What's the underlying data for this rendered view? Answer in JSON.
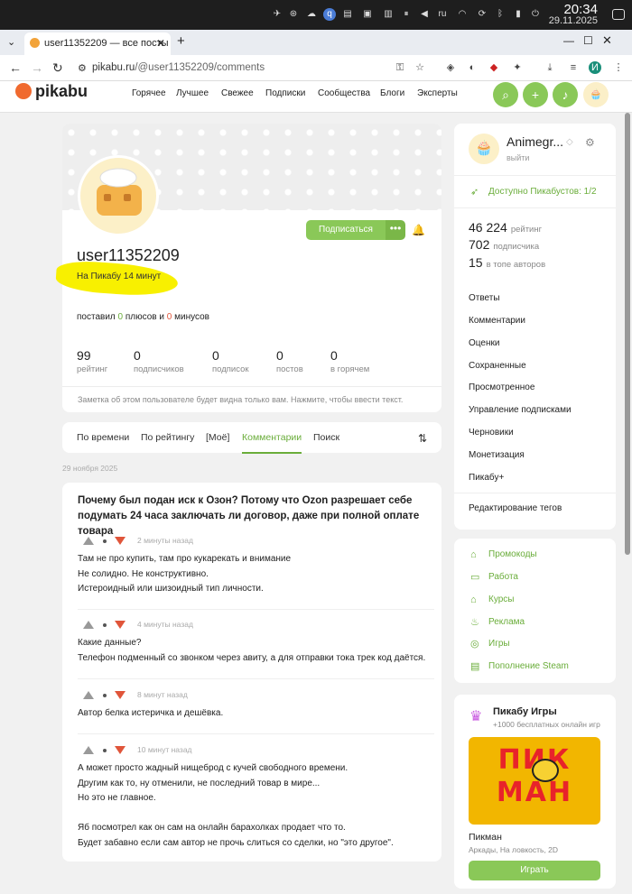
{
  "system": {
    "time": "20:34",
    "date": "29.11.2025",
    "lang": "ru"
  },
  "browser": {
    "tab_title": "user11352209 — все посты",
    "url_domain": "pikabu.ru",
    "url_path": "/@user11352209/comments",
    "profile_initial": "И"
  },
  "site": {
    "logo": "pikabu",
    "menu": [
      "Горячее",
      "Лучшее",
      "Свежее",
      "Подписки",
      "Сообщества",
      "Блоги",
      "Эксперты"
    ]
  },
  "profile": {
    "username": "user11352209",
    "on_site": "На Пикабу 14 минут",
    "subscribe": "Подписаться",
    "more": "•••",
    "votes_prefix": "поставил",
    "plus": "0",
    "plus_label": "плюсов и",
    "minus": "0",
    "minus_label": "минусов",
    "stats": [
      {
        "n": "99",
        "l": "рейтинг"
      },
      {
        "n": "0",
        "l": "подписчиков"
      },
      {
        "n": "0",
        "l": "подписок"
      },
      {
        "n": "0",
        "l": "постов"
      },
      {
        "n": "0",
        "l": "в горячем"
      }
    ],
    "note": "Заметка об этом пользователе будет видна только вам. Нажмите, чтобы ввести текст."
  },
  "tabs": [
    "По времени",
    "По рейтингу",
    "[Моё]",
    "Комментарии",
    "Поиск"
  ],
  "date_group": "29 ноября 2025",
  "post_title": "Почему был подан иск к Озон? Потому что Ozon разрешает себе подумать 24 часа заключать ли договор, даже при полной оплате товара",
  "comments": [
    {
      "ago": "2 минуты назад",
      "text": "Там не про купить, там про кукарекать и внимание\nНе солидно. Не конструктивно.\nИстероидный или шизоидный тип личности."
    },
    {
      "ago": "4 минуты назад",
      "text": "Какие данные?\nТелефон подменный со звонком через авиту, а для отправки тока трек код даётся."
    },
    {
      "ago": "8 минут назад",
      "text": "Автор белка истеричка и дешёвка."
    },
    {
      "ago": "10 минут назад",
      "text": "А может просто жадный нищеброд с кучей свободного времени.\nДругим как то, ну отменили, не последний товар в мире...\nНо это не главное.\n\nЯб посмотрел как он сам на онлайн барахолках продает что то.\nБудет забавно если сам автор не прочь слиться со сделки, но \"это другое\"."
    }
  ],
  "sidebar": {
    "name": "Animegr...",
    "status": "выйти",
    "boost": "Доступно Пикабустов: 1/2",
    "rating": [
      {
        "n": "46 224",
        "l": "рейтинг"
      },
      {
        "n": "702",
        "l": "подписчика"
      },
      {
        "n": "15",
        "l": "в топе авторов"
      }
    ],
    "links": [
      "Ответы",
      "Комментарии",
      "Оценки",
      "Сохраненные",
      "Просмотренное",
      "Управление подписками",
      "Черновики",
      "Монетизация",
      "Пикабу+",
      "Редактирование тегов"
    ],
    "green_links": [
      "Промокоды",
      "Работа",
      "Курсы",
      "Реклама",
      "Игры",
      "Пополнение Steam"
    ],
    "games": {
      "title": "Пикабу Игры",
      "sub": "+1000 бесплатных онлайн игр",
      "game_art_text": "ПИК МАН",
      "game": "Пикман",
      "genre": "Аркады, На ловкость, 2D",
      "play": "Играть"
    }
  }
}
